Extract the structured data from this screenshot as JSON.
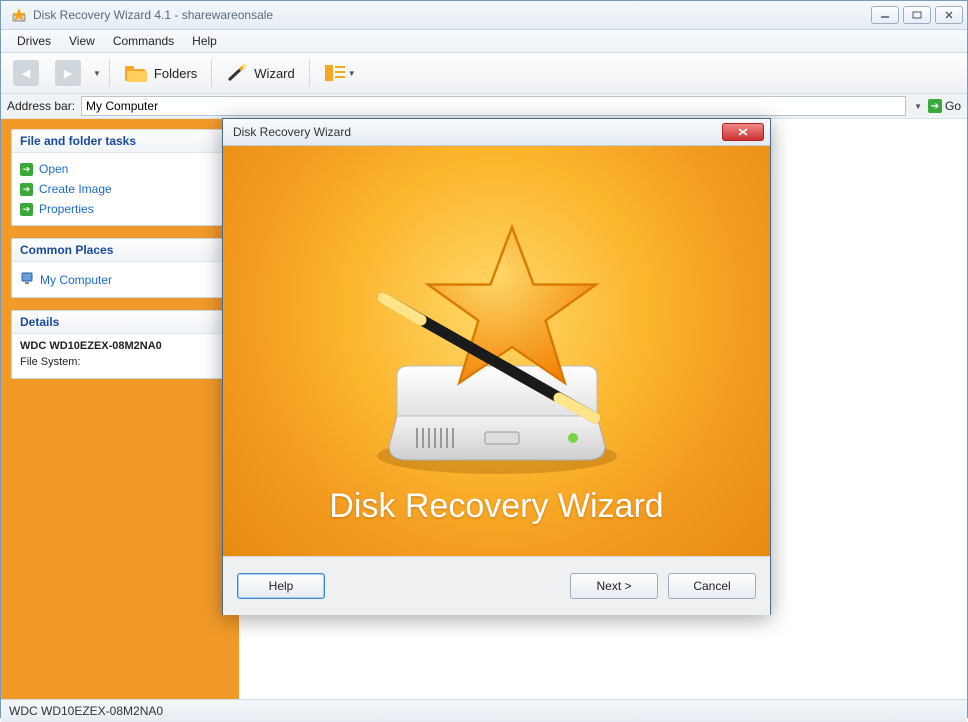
{
  "window": {
    "title": "Disk Recovery Wizard 4.1 - sharewareonsale"
  },
  "menubar": [
    "Drives",
    "View",
    "Commands",
    "Help"
  ],
  "toolbar": {
    "folders_label": "Folders",
    "wizard_label": "Wizard"
  },
  "addressbar": {
    "label": "Address bar:",
    "value": "My Computer",
    "go_label": "Go"
  },
  "sidebar": {
    "tasks_header": "File and folder tasks",
    "tasks": [
      "Open",
      "Create Image",
      "Properties"
    ],
    "places_header": "Common Places",
    "places": [
      "My Computer"
    ],
    "details_header": "Details",
    "details_name": "WDC WD10EZEX-08M2NA0",
    "details_fs_label": "File System:",
    "details_fs_value": ""
  },
  "statusbar": {
    "text": "WDC WD10EZEX-08M2NA0"
  },
  "modal": {
    "title": "Disk Recovery Wizard",
    "hero": "Disk Recovery Wizard",
    "help": "Help",
    "next": "Next >",
    "cancel": "Cancel"
  }
}
